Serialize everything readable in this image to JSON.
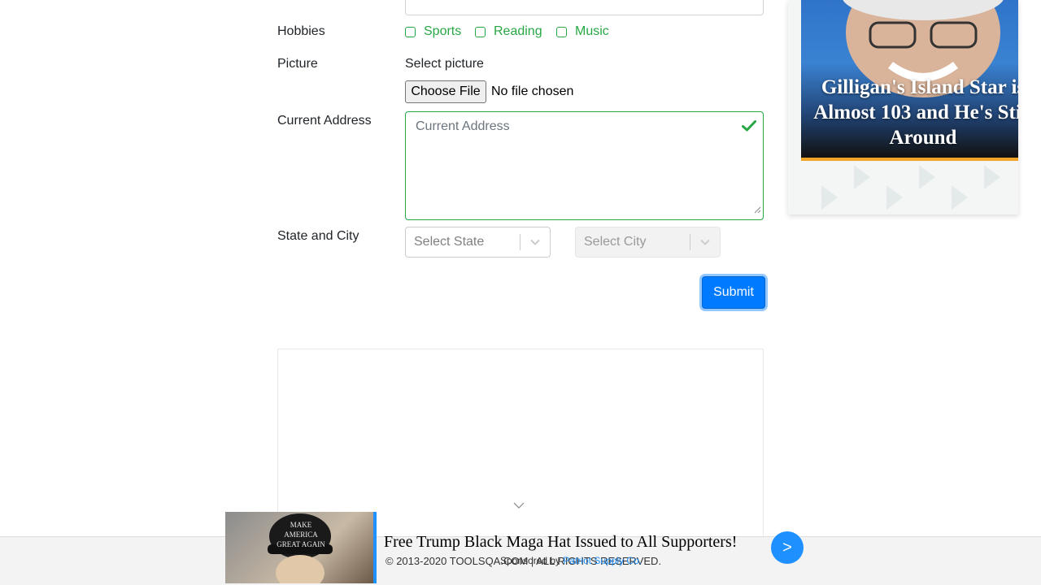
{
  "form": {
    "hobbies_label": "Hobbies",
    "hobbies": [
      {
        "label": "Sports",
        "checked": false
      },
      {
        "label": "Reading",
        "checked": false
      },
      {
        "label": "Music",
        "checked": false
      }
    ],
    "picture_label": "Picture",
    "select_picture_text": "Select picture",
    "file_button_label": "Choose File",
    "file_status": "No file chosen",
    "address_label": "Current Address",
    "address_placeholder": "Current Address",
    "state_city_label": "State and City",
    "state_placeholder": "Select State",
    "city_placeholder": "Select City",
    "submit_label": "Submit"
  },
  "side_ad": {
    "headline": "Gilligan's Island Star is Almost 103 and He's Still Around"
  },
  "bottom_ad": {
    "title": "Free Trump Black Maga Hat Issued to All Supporters!",
    "sponsor_prefix": "Sponsored by ",
    "sponsor_name": "Patriot Supply Co.",
    "next_label": ">",
    "image_text": "MAKE AMERICA GREAT AGAIN"
  },
  "footer": {
    "copyright": "© 2013-2020 TOOLSQA.COM | ALL RIGHTS RESERVED."
  },
  "colors": {
    "success": "#28a745",
    "primary": "#007bff",
    "ad_blue": "#1e90ff"
  }
}
